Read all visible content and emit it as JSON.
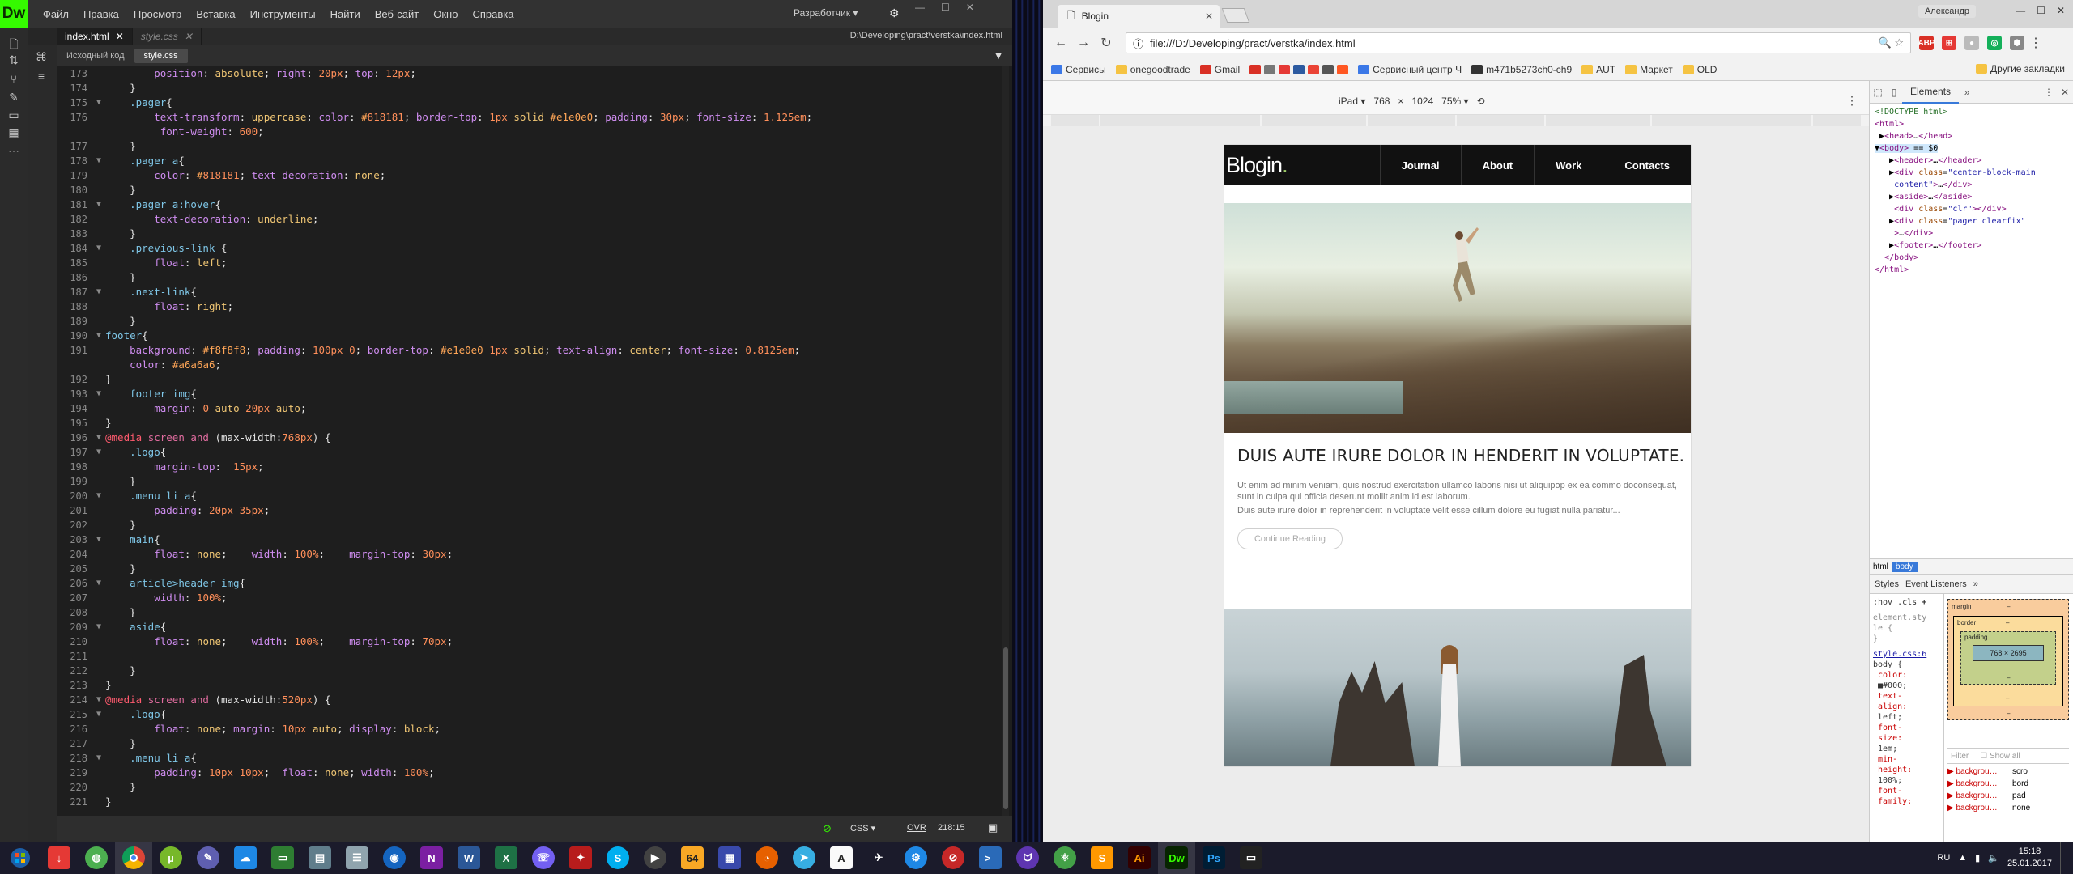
{
  "dreamweaver": {
    "logo": "Dw",
    "menu": [
      "Файл",
      "Правка",
      "Просмотр",
      "Вставка",
      "Инструменты",
      "Найти",
      "Веб-сайт",
      "Окно",
      "Справка"
    ],
    "workspace": "Разработчик",
    "tabs": [
      {
        "label": "index.html",
        "active": true
      },
      {
        "label": "style.css",
        "active": false
      }
    ],
    "file_path": "D:\\Developing\\pract\\verstka\\index.html",
    "subtabs": [
      "Исходный код",
      "style.css"
    ],
    "status": {
      "language": "CSS",
      "mode": "OVR",
      "position": "218:15"
    },
    "code_lines": [
      {
        "n": "173",
        "f": "",
        "t": "        position: absolute; right: 20px; top: 12px;"
      },
      {
        "n": "174",
        "f": "",
        "t": "    }"
      },
      {
        "n": "175",
        "f": "▼",
        "t": "    .pager{"
      },
      {
        "n": "176",
        "f": "",
        "t": "        text-transform: uppercase; color: #818181; border-top: 1px solid #e1e0e0; padding: 30px; font-size: 1.125em;"
      },
      {
        "n": "",
        "f": "",
        "t": "         font-weight: 600;"
      },
      {
        "n": "177",
        "f": "",
        "t": "    }"
      },
      {
        "n": "178",
        "f": "▼",
        "t": "    .pager a{"
      },
      {
        "n": "179",
        "f": "",
        "t": "        color: #818181; text-decoration: none;"
      },
      {
        "n": "180",
        "f": "",
        "t": "    }"
      },
      {
        "n": "181",
        "f": "▼",
        "t": "    .pager a:hover{"
      },
      {
        "n": "182",
        "f": "",
        "t": "        text-decoration: underline;"
      },
      {
        "n": "183",
        "f": "",
        "t": "    }"
      },
      {
        "n": "184",
        "f": "▼",
        "t": "    .previous-link {"
      },
      {
        "n": "185",
        "f": "",
        "t": "        float: left;"
      },
      {
        "n": "186",
        "f": "",
        "t": "    }"
      },
      {
        "n": "187",
        "f": "▼",
        "t": "    .next-link{"
      },
      {
        "n": "188",
        "f": "",
        "t": "        float: right;"
      },
      {
        "n": "189",
        "f": "",
        "t": "    }"
      },
      {
        "n": "190",
        "f": "▼",
        "t": "footer{"
      },
      {
        "n": "191",
        "f": "",
        "t": "    background: #f8f8f8; padding: 100px 0; border-top: #e1e0e0 1px solid; text-align: center; font-size: 0.8125em;"
      },
      {
        "n": "",
        "f": "",
        "t": "    color: #a6a6a6;"
      },
      {
        "n": "192",
        "f": "",
        "t": "}"
      },
      {
        "n": "193",
        "f": "▼",
        "t": "    footer img{"
      },
      {
        "n": "194",
        "f": "",
        "t": "        margin: 0 auto 20px auto;"
      },
      {
        "n": "195",
        "f": "",
        "t": "}"
      },
      {
        "n": "196",
        "f": "▼",
        "t": "@media screen and (max-width:768px) {"
      },
      {
        "n": "197",
        "f": "▼",
        "t": "    .logo{"
      },
      {
        "n": "198",
        "f": "",
        "t": "        margin-top:  15px;"
      },
      {
        "n": "199",
        "f": "",
        "t": "    }"
      },
      {
        "n": "200",
        "f": "▼",
        "t": "    .menu li a{"
      },
      {
        "n": "201",
        "f": "",
        "t": "        padding: 20px 35px;"
      },
      {
        "n": "202",
        "f": "",
        "t": "    }"
      },
      {
        "n": "203",
        "f": "▼",
        "t": "    main{"
      },
      {
        "n": "204",
        "f": "",
        "t": "        float: none;    width: 100%;    margin-top: 30px;"
      },
      {
        "n": "205",
        "f": "",
        "t": "    }"
      },
      {
        "n": "206",
        "f": "▼",
        "t": "    article>header img{"
      },
      {
        "n": "207",
        "f": "",
        "t": "        width: 100%;"
      },
      {
        "n": "208",
        "f": "",
        "t": "    }"
      },
      {
        "n": "209",
        "f": "▼",
        "t": "    aside{"
      },
      {
        "n": "210",
        "f": "",
        "t": "        float: none;    width: 100%;    margin-top: 70px;"
      },
      {
        "n": "211",
        "f": "",
        "t": ""
      },
      {
        "n": "212",
        "f": "",
        "t": "    }"
      },
      {
        "n": "213",
        "f": "",
        "t": "}"
      },
      {
        "n": "214",
        "f": "▼",
        "t": "@media screen and (max-width:520px) {"
      },
      {
        "n": "215",
        "f": "▼",
        "t": "    .logo{"
      },
      {
        "n": "216",
        "f": "",
        "t": "        float: none; margin: 10px auto; display: block;"
      },
      {
        "n": "217",
        "f": "",
        "t": "    }"
      },
      {
        "n": "218",
        "f": "▼",
        "t": "    .menu li a{"
      },
      {
        "n": "219",
        "f": "",
        "t": "        padding: 10px 10px;  float: none; width: 100%;"
      },
      {
        "n": "220",
        "f": "",
        "t": "    }"
      },
      {
        "n": "221",
        "f": "",
        "t": "}"
      }
    ]
  },
  "chrome": {
    "tab_title": "Blogin",
    "user": "Александр",
    "url": "file:///D:/Developing/pract/verstka/index.html",
    "bookmarks": [
      "Сервисы",
      "onegoodtrade",
      "Gmail",
      "Сервисный центр Ч",
      "m471b5273ch0-ch9",
      "AUT",
      "Маркет",
      "OLD"
    ],
    "other_bookmarks": "Другие закладки",
    "device": {
      "name": "iPad",
      "width": "768",
      "x": "×",
      "height": "1024",
      "zoom": "75%"
    }
  },
  "blog": {
    "logo": "Blogin",
    "logo_dot": ".",
    "nav": [
      "Journal",
      "About",
      "Work",
      "Contacts"
    ],
    "post_title": "DUIS AUTE IRURE DOLOR IN HENDERIT IN VOLUPTATE.",
    "p1": "Ut enim ad minim veniam, quis nostrud exercitation ullamco laboris nisi ut aliquipop ex ea commo doconsequat, sunt in culpa qui officia deserunt mollit anim id est laborum.",
    "p2": "Duis aute irure dolor in reprehenderit in voluptate velit esse cillum dolore eu fugiat nulla pariatur...",
    "continue": "Continue Reading"
  },
  "devtools": {
    "tab": "Elements",
    "crumbs": [
      "html",
      "body"
    ],
    "subtabs": [
      "Styles",
      "Event Listeners"
    ],
    "filter_hov": ":hov",
    "filter_cls": ".cls",
    "box_labels": {
      "margin": "margin",
      "border": "border",
      "padding": "padding",
      "content": "768 × 2695",
      "dash": "–"
    },
    "filter_placeholder": "Filter",
    "show_all": "Show all",
    "computed": [
      {
        "name": "backgrou…",
        "value": "scro"
      },
      {
        "name": "backgrou…",
        "value": "bord"
      },
      {
        "name": "backgrou…",
        "value": "pad"
      },
      {
        "name": "backgrou…",
        "value": "none"
      }
    ]
  },
  "taskbar": {
    "lang": "RU",
    "time": "15:18",
    "date": "25.01.2017",
    "badge_64": "64"
  }
}
